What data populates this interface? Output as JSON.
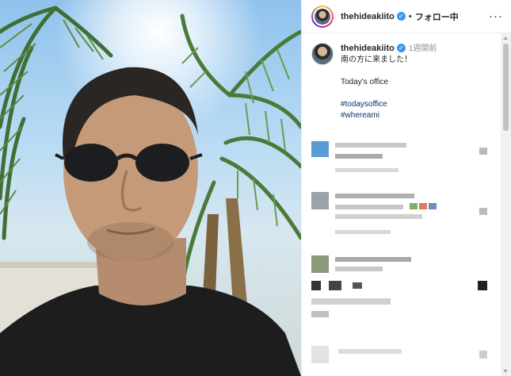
{
  "post": {
    "username": "thehideakiito",
    "follow_label": "フォロー中",
    "separator": "•",
    "more_label": "···",
    "verified_mark": "✓"
  },
  "caption": {
    "username": "thehideakiito",
    "time": "1週間前",
    "line1": "南の方に来ました！",
    "line2": "Today's office",
    "hashtags": [
      "#todaysoffice",
      "#whereami"
    ]
  },
  "colors": {
    "link": "#00376b",
    "verified": "#3897f0",
    "pixelated": "#c8c8c8"
  },
  "icons": [
    "verified-badge-icon",
    "more-options-icon",
    "heart-icon"
  ]
}
